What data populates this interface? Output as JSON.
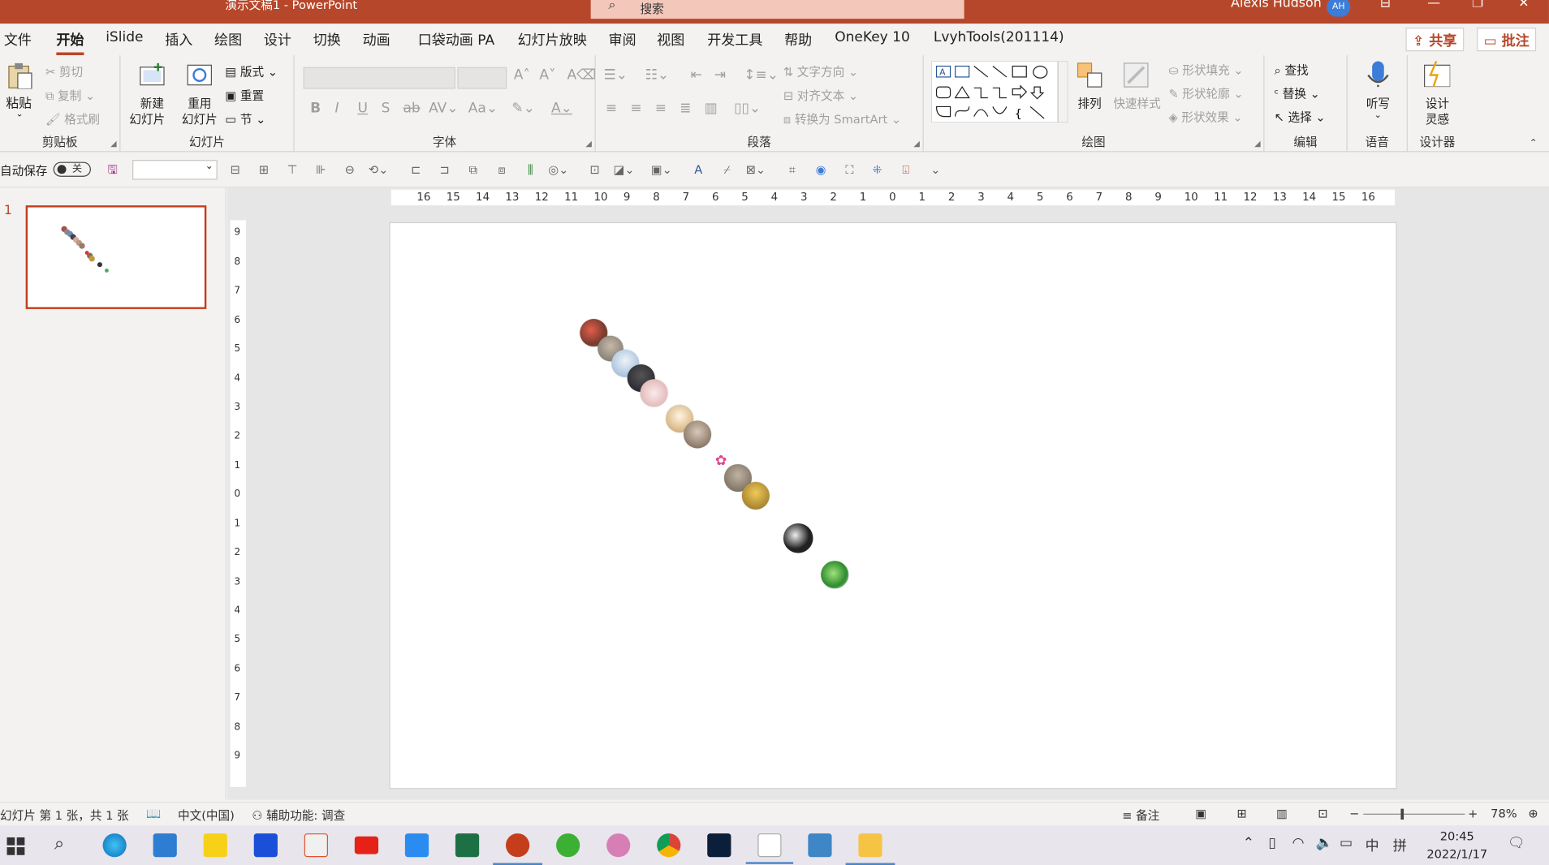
{
  "app": {
    "title": "演示文稿1  -  PowerPoint",
    "search_placeholder": "搜索",
    "user_name": "Alexis Hudson",
    "user_initials": "AH",
    "accent": "#b7472a"
  },
  "tabs": [
    "文件",
    "开始",
    "iSlide",
    "插入",
    "绘图",
    "设计",
    "切换",
    "动画",
    "口袋动画 PA",
    "幻灯片放映",
    "审阅",
    "视图",
    "开发工具",
    "帮助",
    "OneKey 10",
    "LvyhTools(201114)"
  ],
  "active_tab": "开始",
  "top_buttons": {
    "share": "共享",
    "comments": "批注"
  },
  "ribbon": {
    "clipboard": {
      "label": "剪贴板",
      "paste": "粘贴",
      "cut": "剪切",
      "copy": "复制",
      "format_painter": "格式刷"
    },
    "slides": {
      "label": "幻灯片",
      "new_slide_1": "新建",
      "new_slide_2": "幻灯片",
      "reuse_1": "重用",
      "reuse_2": "幻灯片",
      "layout": "版式",
      "reset": "重置",
      "section": "节"
    },
    "font": {
      "label": "字体"
    },
    "paragraph": {
      "label": "段落",
      "text_direction": "文字方向",
      "align_text": "对齐文本",
      "smartart": "转换为 SmartArt"
    },
    "drawing": {
      "label": "绘图",
      "arrange": "排列",
      "quick_styles": "快速样式",
      "shape_fill": "形状填充",
      "shape_outline": "形状轮廓",
      "shape_effects": "形状效果"
    },
    "editing": {
      "label": "编辑",
      "find": "查找",
      "replace": "替换",
      "select": "选择"
    },
    "voice": {
      "label": "语音",
      "dictate": "听写"
    },
    "designer": {
      "label": "设计器",
      "design_ideas_1": "设计",
      "design_ideas_2": "灵感"
    }
  },
  "qat": {
    "autosave": "自动保存",
    "autosave_state": "关"
  },
  "thumbnail": {
    "slide_number": "1"
  },
  "rulers": {
    "horizontal": [
      "16",
      "15",
      "14",
      "13",
      "12",
      "11",
      "10",
      "9",
      "8",
      "7",
      "6",
      "5",
      "4",
      "3",
      "2",
      "1",
      "0",
      "1",
      "2",
      "3",
      "4",
      "5",
      "6",
      "7",
      "8",
      "9",
      "10",
      "11",
      "12",
      "13",
      "14",
      "15",
      "16"
    ],
    "vertical": [
      "9",
      "8",
      "7",
      "6",
      "5",
      "4",
      "3",
      "2",
      "1",
      "0",
      "1",
      "2",
      "3",
      "4",
      "5",
      "6",
      "7",
      "8",
      "9"
    ]
  },
  "status": {
    "slide_info": "幻灯片 第 1 张，共 1 张",
    "language": "中文(中国)",
    "accessibility": "辅助功能: 调查",
    "notes": "备注",
    "zoom": "78%"
  },
  "taskbar": {
    "time": "20:45",
    "date": "2022/1/17",
    "ime": "中",
    "ime2": "拼"
  }
}
